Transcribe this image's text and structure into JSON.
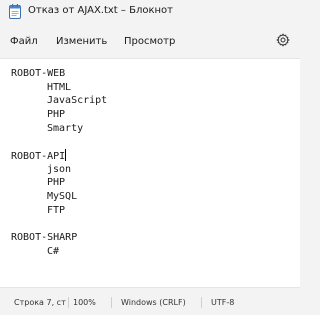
{
  "window": {
    "title": "Отказ от AJAX.txt – Блокнот",
    "app_icon": "notepad-icon"
  },
  "menu": {
    "file": "Файл",
    "edit": "Изменить",
    "view": "Просмотр",
    "settings_icon": "gear-icon"
  },
  "editor": {
    "lines": [
      {
        "text": "ROBOT-WEB",
        "indent": false
      },
      {
        "text": "HTML",
        "indent": true
      },
      {
        "text": "JavaScript",
        "indent": true
      },
      {
        "text": "PHP",
        "indent": true
      },
      {
        "text": "Smarty",
        "indent": true
      },
      {
        "text": "",
        "indent": false
      },
      {
        "text": "ROBOT-API",
        "indent": false,
        "caret": true
      },
      {
        "text": "json",
        "indent": true
      },
      {
        "text": "PHP",
        "indent": true
      },
      {
        "text": "MySQL",
        "indent": true
      },
      {
        "text": "FTP",
        "indent": true
      },
      {
        "text": "",
        "indent": false
      },
      {
        "text": "ROBOT-SHARP",
        "indent": false
      },
      {
        "text": "C#",
        "indent": true
      }
    ]
  },
  "status": {
    "position": "Строка 7, ст",
    "zoom": "100%",
    "line_ending": "Windows (CRLF)",
    "encoding": "UTF-8"
  },
  "colors": {
    "chrome": "#f3f3f3",
    "editor_bg": "#ffffff",
    "text": "#1a1a1a"
  }
}
